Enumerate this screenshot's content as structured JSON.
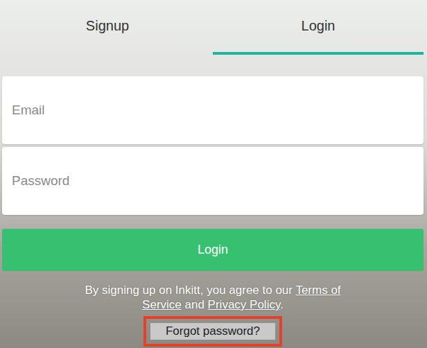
{
  "tabs": [
    {
      "label": "Signup",
      "selected": false
    },
    {
      "label": "Login",
      "selected": true
    }
  ],
  "fields": [
    {
      "placeholder": "Email",
      "kind": "email"
    },
    {
      "placeholder": "Password",
      "kind": "password"
    }
  ],
  "submit": {
    "label": "Login"
  },
  "legal": {
    "prefix": "By signing up on Inkitt, you agree to our ",
    "links": [
      "Terms of Service",
      "Privacy Policy"
    ],
    "joiner": " and ",
    "suffix": "."
  },
  "forgot": {
    "label": "Forgot password?",
    "highlighted": true
  }
}
